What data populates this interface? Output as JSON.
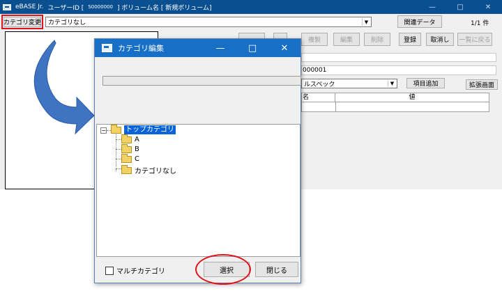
{
  "app": {
    "name": "eBASE Jr.",
    "user_label": "ユーザーID [",
    "user_id": "S0000000",
    "volume_label": "] ボリューム名 [ 新規ボリューム]",
    "window_buttons": [
      "—",
      "□",
      "✕"
    ]
  },
  "toolbar": {
    "category_change": "カテゴリ変更",
    "category_value": "カテゴリなし",
    "related_data": "関連データ",
    "page_count": "1/1 件"
  },
  "actions": {
    "copy": "複製",
    "edit": "編集",
    "delete": "削除",
    "register": "登録",
    "cancel": "取消し",
    "back_to_list": "一覧に戻る"
  },
  "detail": {
    "id_value": "000001",
    "spec_value": "ルスペック",
    "add_item": "項目追加",
    "expand_screen": "拡張画面",
    "col_name": "名",
    "col_value": "値"
  },
  "dialog": {
    "title": "カテゴリ編集",
    "window_buttons": [
      "—",
      "□",
      "✕"
    ],
    "tree": {
      "root": "トップカテゴリ",
      "children": [
        "A",
        "B",
        "C",
        "カテゴリなし"
      ]
    },
    "multi_category": "マルチカテゴリ",
    "select": "選択",
    "close": "閉じる"
  },
  "colors": {
    "main_titlebar": "#0a4f8f",
    "dialog_titlebar": "#1770c6",
    "highlight_red": "#e0121a",
    "arrow_blue": "#3e74c2",
    "tree_selection": "#0a64d8"
  }
}
